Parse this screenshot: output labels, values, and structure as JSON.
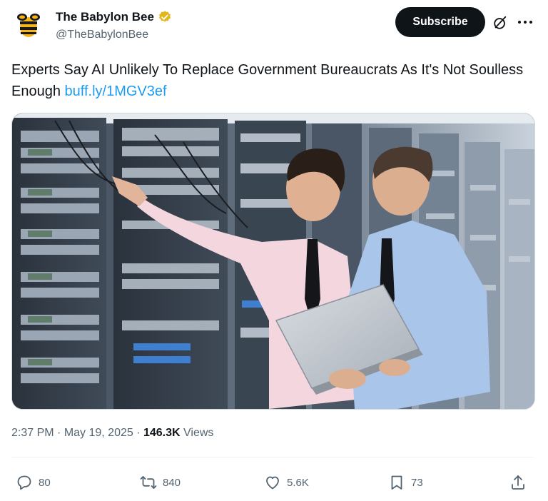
{
  "author": {
    "name": "The Babylon Bee",
    "handle": "@TheBabylonBee"
  },
  "buttons": {
    "subscribe": "Subscribe"
  },
  "tweet": {
    "text": "Experts Say AI Unlikely To Replace Government Bureaucrats As It's Not Soulless Enough",
    "link": "buff.ly/1MGV3ef"
  },
  "meta": {
    "time": "2:37 PM",
    "separator1": " · ",
    "date": "May 19, 2025",
    "separator2": " · ",
    "views_count": "146.3K",
    "views_label": " Views"
  },
  "actions": {
    "replies": "80",
    "reposts": "840",
    "likes": "5.6K",
    "bookmarks": "73"
  },
  "icons": {
    "verified": "verified-badge-icon",
    "grok": "grok-icon",
    "more": "more-icon",
    "reply": "reply-icon",
    "repost": "repost-icon",
    "like": "heart-icon",
    "bookmark": "bookmark-icon",
    "share": "share-icon"
  },
  "colors": {
    "link": "#1d9bf0",
    "verified_gold": "#e2b719",
    "subscribe_bg": "#0f1419",
    "secondary_text": "#536471"
  }
}
